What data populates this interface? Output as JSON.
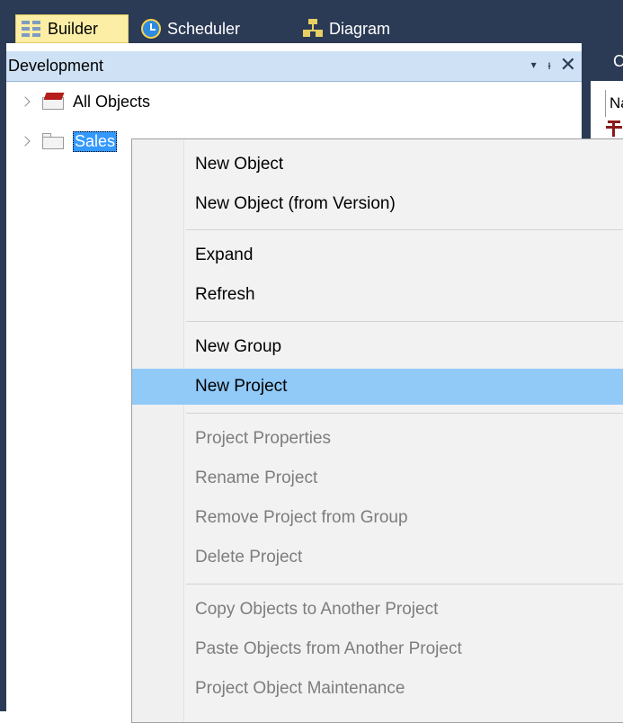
{
  "tabs": {
    "builder": "Builder",
    "scheduler": "Scheduler",
    "diagram": "Diagram"
  },
  "panel": {
    "title": "Development",
    "dropdown_glyph": "▾",
    "pin_glyph": " ᵻ",
    "close_glyph": "✕"
  },
  "right_panel": {
    "header_fragment": "C",
    "column_fragment": "Na"
  },
  "tree": {
    "items": [
      {
        "label": "All Objects",
        "icon": "red-folder-icon"
      },
      {
        "label": "Sales",
        "icon": "folder-icon",
        "selected": true
      }
    ]
  },
  "context_menu": {
    "groups": [
      [
        {
          "label": "New Object",
          "enabled": true
        },
        {
          "label": "New Object (from Version)",
          "enabled": true
        }
      ],
      [
        {
          "label": "Expand",
          "enabled": true
        },
        {
          "label": "Refresh",
          "enabled": true
        }
      ],
      [
        {
          "label": "New Group",
          "enabled": true
        },
        {
          "label": "New Project",
          "enabled": true,
          "highlighted": true
        }
      ],
      [
        {
          "label": "Project Properties",
          "enabled": false
        },
        {
          "label": "Rename Project",
          "enabled": false
        },
        {
          "label": "Remove Project from Group",
          "enabled": false
        },
        {
          "label": "Delete Project",
          "enabled": false
        }
      ],
      [
        {
          "label": "Copy Objects to Another Project",
          "enabled": false
        },
        {
          "label": "Paste Objects from Another Project",
          "enabled": false
        },
        {
          "label": "Project Object Maintenance",
          "enabled": false
        }
      ]
    ]
  },
  "colors": {
    "dark_chrome": "#2b3a55",
    "active_tab": "#fceea5",
    "panel_header": "#cfe2f5",
    "selection": "#3399ff",
    "menu_highlight": "#91c9f7",
    "disabled_text": "#7d7d7d"
  }
}
